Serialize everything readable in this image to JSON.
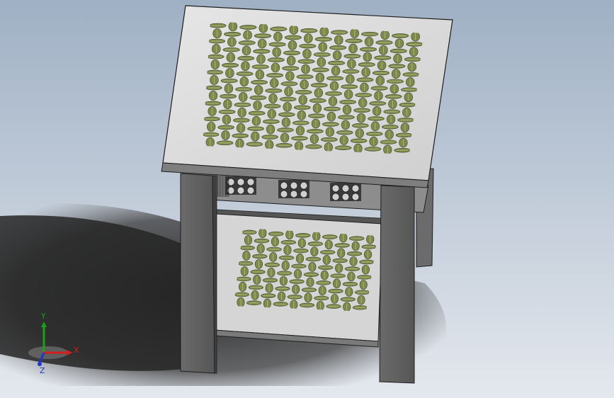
{
  "viewport": {
    "background_top": "#9fb0c4",
    "background_bottom": "#e4e8ee",
    "shadow_color": "#2b2b2b"
  },
  "model": {
    "part_color_light": "#d7d7d7",
    "part_color_mid": "#a9a9a9",
    "part_color_dark": "#5f5f5f",
    "edge_color": "#1e1e1e",
    "weave_color": "#7d8a4c",
    "weave_highlight": "#b5bf86",
    "weave_dark": "#3e4526"
  },
  "triad": {
    "x_label": "X",
    "y_label": "Y",
    "z_label": "Z",
    "x_color": "#d11f1f",
    "y_color": "#1aa01a",
    "z_color": "#1f36c8"
  }
}
